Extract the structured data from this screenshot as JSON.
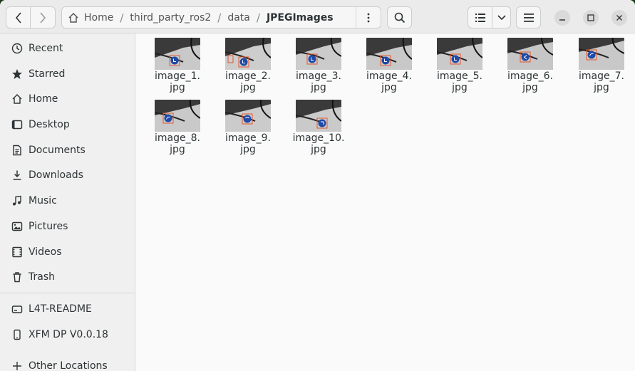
{
  "nav": {
    "back_icon": "go-back-icon",
    "forward_icon": "go-forward-icon"
  },
  "path": {
    "home_label": "Home",
    "segments": [
      "third_party_ros2",
      "data"
    ],
    "current": "JPEGImages",
    "separator": "/"
  },
  "toolbar": {
    "search_icon": "search-icon",
    "view_icon": "list-view-icon",
    "view_dropdown_icon": "chevron-down-icon",
    "menu_icon": "hamburger-menu-icon"
  },
  "window_controls": [
    "minimize-icon",
    "maximize-icon",
    "close-icon"
  ],
  "sidebar": {
    "items": [
      {
        "label": "Recent",
        "icon": "clock-icon"
      },
      {
        "label": "Starred",
        "icon": "star-icon"
      },
      {
        "label": "Home",
        "icon": "home-icon"
      },
      {
        "label": "Desktop",
        "icon": "desktop-icon"
      },
      {
        "label": "Documents",
        "icon": "document-icon"
      },
      {
        "label": "Downloads",
        "icon": "download-icon"
      },
      {
        "label": "Music",
        "icon": "music-icon"
      },
      {
        "label": "Pictures",
        "icon": "picture-icon"
      },
      {
        "label": "Videos",
        "icon": "video-icon"
      },
      {
        "label": "Trash",
        "icon": "trash-icon"
      }
    ],
    "devices": [
      {
        "label": "L4T-README",
        "icon": "drive-icon"
      },
      {
        "label": "XFM DP V0.0.18",
        "icon": "phone-icon"
      }
    ],
    "other": {
      "label": "Other Locations",
      "icon": "plus-icon"
    }
  },
  "files": [
    {
      "line1": "image_1.",
      "line2": "jpg"
    },
    {
      "line1": "image_2.",
      "line2": "jpg"
    },
    {
      "line1": "image_3.",
      "line2": "jpg"
    },
    {
      "line1": "image_4.",
      "line2": "jpg"
    },
    {
      "line1": "image_5.",
      "line2": "jpg"
    },
    {
      "line1": "image_6.",
      "line2": "jpg"
    },
    {
      "line1": "image_7.",
      "line2": "jpg"
    },
    {
      "line1": "image_8.",
      "line2": "jpg"
    },
    {
      "line1": "image_9.",
      "line2": "jpg"
    },
    {
      "line1": "image_10.",
      "line2": "jpg"
    }
  ],
  "colors": {
    "sign_blue": "#1f4aa8",
    "box_orange": "#e4572e"
  }
}
